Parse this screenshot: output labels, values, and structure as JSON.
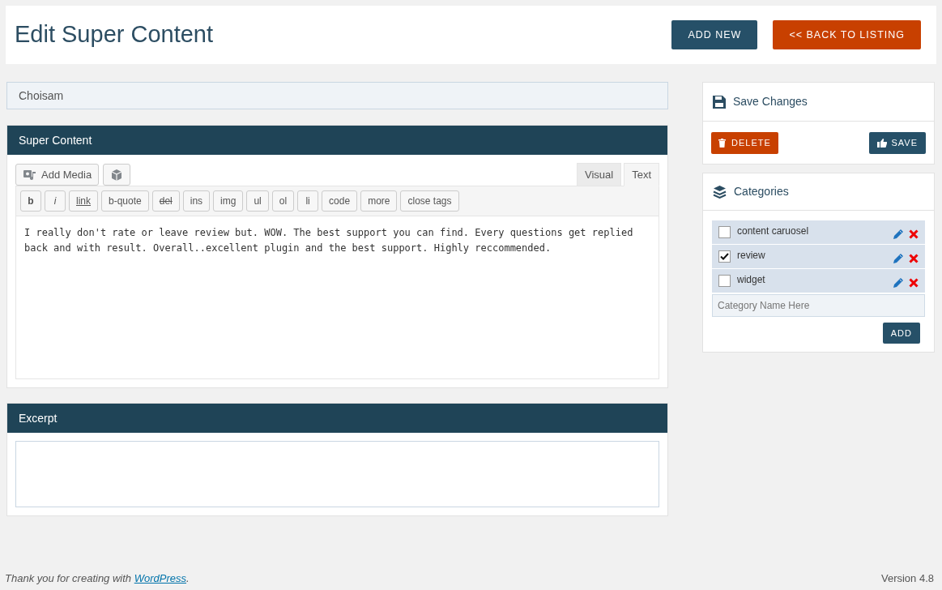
{
  "header": {
    "title": "Edit Super Content",
    "buttons": [
      {
        "label": "ADD NEW",
        "kind": "primary"
      },
      {
        "label": "<< BACK TO LISTING",
        "kind": "danger"
      }
    ]
  },
  "title_field": {
    "value": "Choisam"
  },
  "content_panel": {
    "heading": "Super Content",
    "add_media": "Add Media",
    "tabs": [
      {
        "label": "Visual",
        "selected": false
      },
      {
        "label": "Text",
        "selected": true
      }
    ],
    "quicktags": [
      {
        "label": "b",
        "kind": "bold"
      },
      {
        "label": "i",
        "kind": "italic"
      },
      {
        "label": "link",
        "kind": "underline"
      },
      {
        "label": "b-quote",
        "kind": "plain"
      },
      {
        "label": "del",
        "kind": "strike"
      },
      {
        "label": "ins",
        "kind": "plain"
      },
      {
        "label": "img",
        "kind": "plain"
      },
      {
        "label": "ul",
        "kind": "plain"
      },
      {
        "label": "ol",
        "kind": "plain"
      },
      {
        "label": "li",
        "kind": "plain"
      },
      {
        "label": "code",
        "kind": "plain"
      },
      {
        "label": "more",
        "kind": "plain"
      },
      {
        "label": "close tags",
        "kind": "plain"
      }
    ],
    "text": "I really don't rate or leave review but. WOW. The best support you can find. Every questions get replied back and with result. Overall..excellent plugin and the best support. Highly reccommended."
  },
  "excerpt_panel": {
    "heading": "Excerpt"
  },
  "save_box": {
    "heading": "Save Changes",
    "delete": "DELETE",
    "save": "SAVE"
  },
  "categories_box": {
    "heading": "Categories",
    "items": [
      {
        "label": "content caruosel",
        "checked": false
      },
      {
        "label": "review",
        "checked": true
      },
      {
        "label": "widget",
        "checked": false
      }
    ],
    "placeholder": "Category Name Here",
    "add": "ADD"
  },
  "footer": {
    "before": "Thank you for creating with ",
    "link": "WordPress",
    "after": ".",
    "version": "Version 4.8"
  }
}
